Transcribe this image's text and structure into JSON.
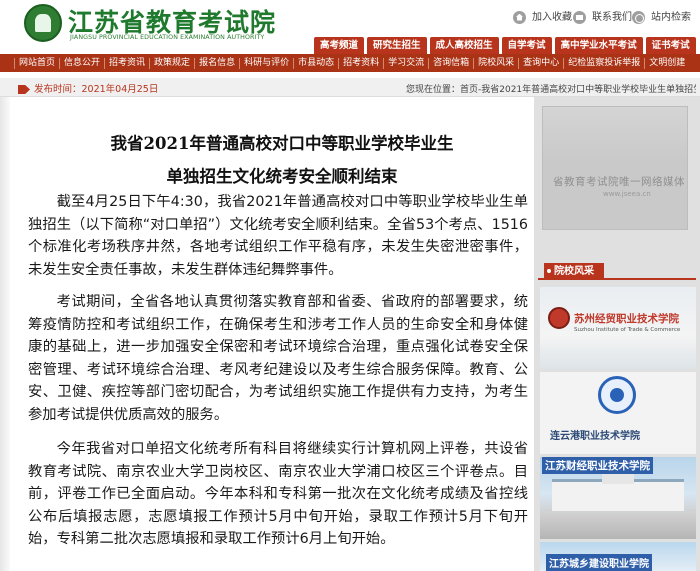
{
  "header": {
    "site_name": "江苏省教育考试院",
    "site_name_en": "JIANGSU PROVINCIAL EDUCATION EXAMINATION AUTHORITY",
    "tools": [
      {
        "label": "加入收藏",
        "icon": "home-icon"
      },
      {
        "label": "联系我们",
        "icon": "contact-icon"
      },
      {
        "label": "站内检索",
        "icon": "map-icon"
      }
    ],
    "tabs": [
      "高考频道",
      "研究生招生",
      "成人高校招生",
      "自学考试",
      "高中学业水平考试",
      "证书考试"
    ]
  },
  "nav": {
    "items": [
      "网站首页",
      "信息公开",
      "招考资讯",
      "政策规定",
      "报名信息",
      "科研与评价",
      "市县动态",
      "招考资料",
      "学习交流",
      "咨询信箱",
      "院校风采",
      "查询中心",
      "纪检监察投诉举报",
      "文明创建"
    ]
  },
  "info": {
    "publish_time": "发布时间：2021年04月25日",
    "breadcrumb": "您现在位置：首页-我省2021年普通高校对口中等职业学校毕业生单独招生..."
  },
  "article": {
    "title_line1": "我省2021年普通高校对口中等职业学校毕业生",
    "title_line2": "单独招生文化统考安全顺利结束",
    "paragraphs": [
      "截至4月25日下午4:30，我省2021年普通高校对口中等职业学校毕业生单独招生（以下简称“对口单招”）文化统考安全顺利结束。全省53个考点、1516个标准化考场秩序井然，各地考试组织工作平稳有序，未发生失密泄密事件，未发生安全责任事故，未发生群体违纪舞弊事件。",
      "考试期间，全省各地认真贯彻落实教育部和省委、省政府的部署要求，统筹疫情防控和考试组织工作，在确保考生和涉考工作人员的生命安全和身体健康的基础上，进一步加强安全保密和考试环境综合治理，重点强化试卷安全保密管理、考试环境综合治理、考风考纪建设以及考生综合服务保障。教育、公安、卫健、疾控等部门密切配合，为考试组织实施工作提供有力支持，为考生参加考试提供优质高效的服务。",
      "今年我省对口单招文化统考所有科目将继续实行计算机网上评卷，共设省教育考试院、南京农业大学卫岗校区、南京农业大学浦口校区三个评卷点。目前，评卷工作已全面启动。今年本科和专科第一批次在文化统考成绩及省控线公布后填报志愿，志愿填报工作预计5月中旬开始，录取工作预计5月下旬开始，专科第二批次志愿填报和录取工作预计6月上旬开始。"
    ]
  },
  "sidebar": {
    "banner_text": "省教育考试院唯一网络媒体",
    "banner_url": "www.jseea.cn",
    "box_title": "院校风采",
    "campuses": [
      {
        "name": "苏州经贸职业技术学院",
        "sub": "Suzhou Institute of Trade & Commerce"
      },
      {
        "name": "连云港职业技术学院"
      },
      {
        "name": "江苏财经职业技术学院"
      },
      {
        "name": "江苏城乡建设职业学院"
      }
    ]
  }
}
